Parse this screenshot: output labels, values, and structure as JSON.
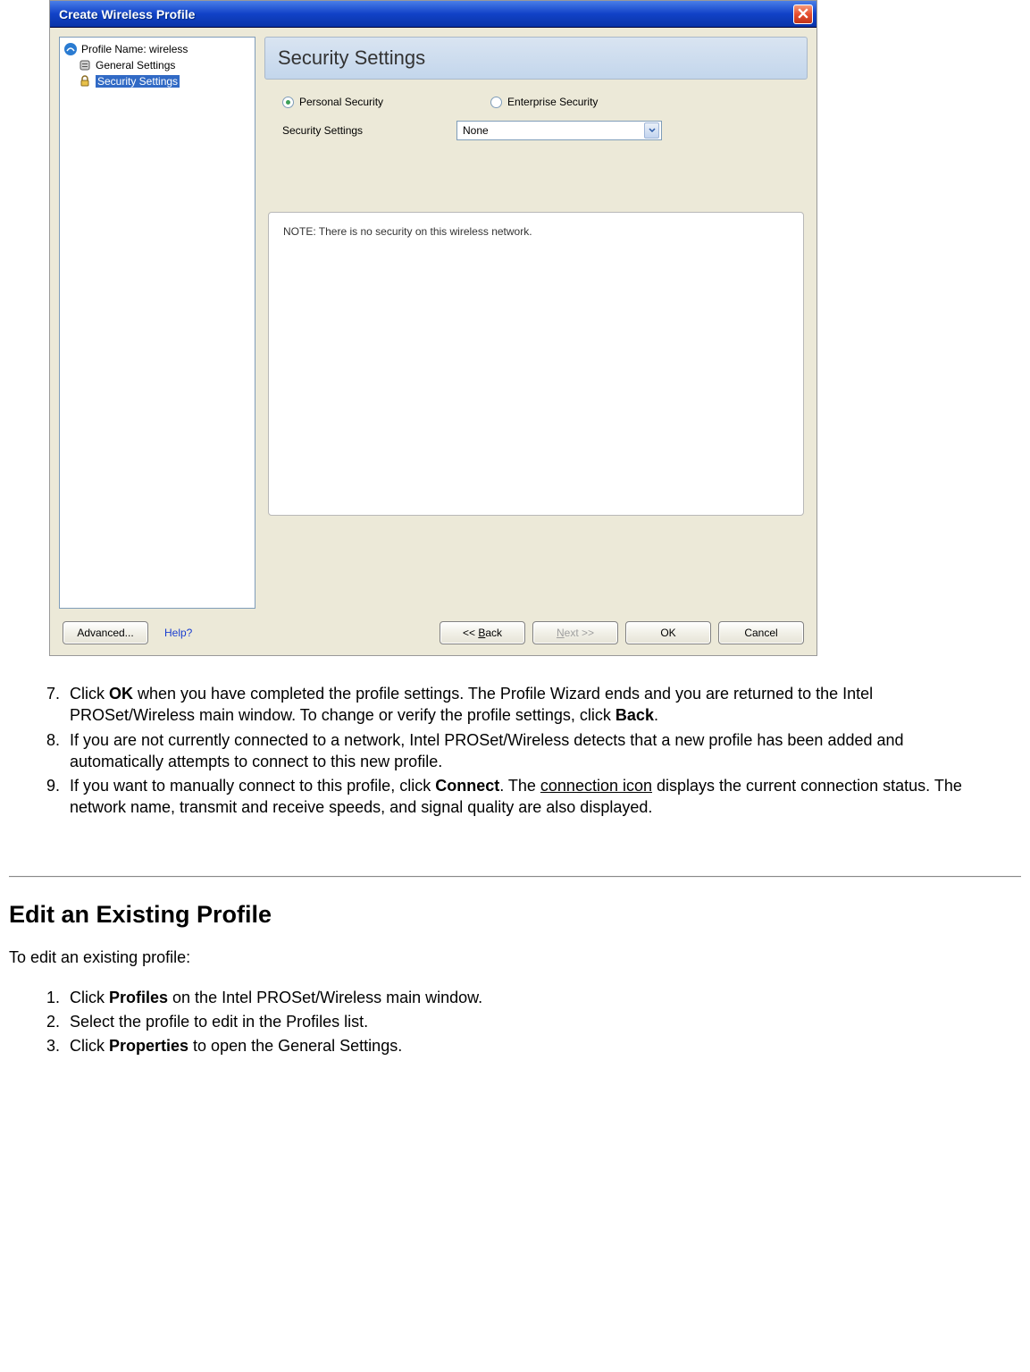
{
  "dialog": {
    "title": "Create Wireless Profile",
    "tree": {
      "root": {
        "label": "Profile Name: wireless"
      },
      "item1": {
        "label": "General Settings"
      },
      "item2": {
        "label": "Security Settings"
      }
    },
    "section_header": "Security Settings",
    "radios": {
      "personal": "Personal Security",
      "enterprise": "Enterprise Security"
    },
    "settings_label": "Security Settings",
    "dropdown_value": "None",
    "note_text": "NOTE: There is no security on this wireless network.",
    "buttons": {
      "advanced": "Advanced...",
      "help": "Help?",
      "back": "<< Back",
      "back_key": "B",
      "next": "Next >>",
      "next_key": "N",
      "ok": "OK",
      "cancel": "Cancel"
    }
  },
  "doc": {
    "list1": {
      "start": 7,
      "item7_a": "Click ",
      "item7_b": "OK",
      "item7_c": " when you have completed the profile settings. The Profile Wizard ends and you are returned to the Intel PROSet/Wireless main window. To change or verify the profile settings, click ",
      "item7_d": "Back",
      "item7_e": ".",
      "item8": "If you are not currently connected to a network, Intel PROSet/Wireless detects that a new profile has been added and automatically attempts to connect to this new profile.",
      "item9_a": "If you want to manually connect to this profile, click ",
      "item9_b": "Connect",
      "item9_c": ". The ",
      "item9_link": "connection icon",
      "item9_d": " displays the current connection status. The network name, transmit and receive speeds, and signal quality are also displayed."
    },
    "heading": "Edit an Existing Profile",
    "intro": "To edit an existing profile:",
    "list2": {
      "item1_a": "Click ",
      "item1_b": "Profiles",
      "item1_c": " on the Intel PROSet/Wireless main window.",
      "item2": "Select the profile to edit in the Profiles list.",
      "item3_a": "Click ",
      "item3_b": "Properties",
      "item3_c": " to open the General Settings."
    }
  }
}
